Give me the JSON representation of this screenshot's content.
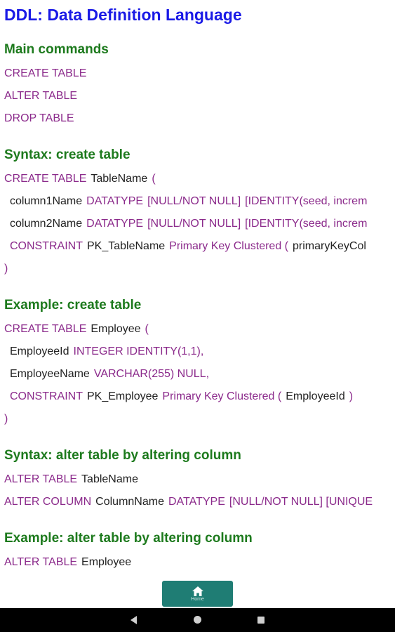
{
  "title": "DDL: Data Definition Language",
  "sections": {
    "main": {
      "heading": "Main commands",
      "lines": [
        {
          "kw1": "CREATE TABLE"
        },
        {
          "kw1": "ALTER TABLE"
        },
        {
          "kw1": "DROP TABLE"
        }
      ]
    },
    "syntax_create": {
      "heading": "Syntax: create table",
      "l1": {
        "kw": "CREATE TABLE",
        "name": "TableName",
        "paren": "("
      },
      "l2": {
        "name": "column1Name",
        "kw1": "DATATYPE",
        "kw2": "[NULL/NOT NULL]",
        "kw3": "[IDENTITY(seed, increm"
      },
      "l3": {
        "name": "column2Name",
        "kw1": "DATATYPE",
        "kw2": "[NULL/NOT NULL]",
        "kw3": "[IDENTITY(seed, increm"
      },
      "l4": {
        "kw1": "CONSTRAINT",
        "name": "PK_TableName",
        "kw2": "Primary Key Clustered (",
        "col": "primaryKeyCol"
      },
      "l5": {
        "paren": ")"
      }
    },
    "example_create": {
      "heading": "Example: create table",
      "l1": {
        "kw": "CREATE TABLE",
        "name": "Employee",
        "paren": "("
      },
      "l2": {
        "name": "EmployeeId",
        "kw1": "INTEGER IDENTITY(1,1),"
      },
      "l3": {
        "name": "EmployeeName",
        "kw1": "VARCHAR(255) NULL,"
      },
      "l4": {
        "kw1": "CONSTRAINT",
        "name": "PK_Employee",
        "kw2": "Primary Key Clustered (",
        "col": "EmployeeId",
        "paren": ")"
      },
      "l5": {
        "paren": ")"
      }
    },
    "syntax_alter": {
      "heading": "Syntax: alter table by altering column",
      "l1": {
        "kw": "ALTER TABLE",
        "name": "TableName"
      },
      "l2": {
        "kw1": "ALTER COLUMN",
        "name": "ColumnName",
        "kw2": "DATATYPE",
        "kw3": "[NULL/NOT NULL] [UNIQUE"
      }
    },
    "example_alter": {
      "heading": "Example: alter table by altering column",
      "l1": {
        "kw": "ALTER TABLE",
        "name": "Employee"
      }
    }
  },
  "home_button": {
    "label": "Home",
    "icon": "home-icon"
  },
  "nav_bar": {
    "back": "back-icon",
    "home": "home-circle-icon",
    "recents": "recents-icon"
  },
  "colors": {
    "title": "#1a1ae6",
    "heading": "#1d7a1d",
    "keyword": "#8b2a8b",
    "text": "#222222",
    "button": "#1f7d74"
  }
}
